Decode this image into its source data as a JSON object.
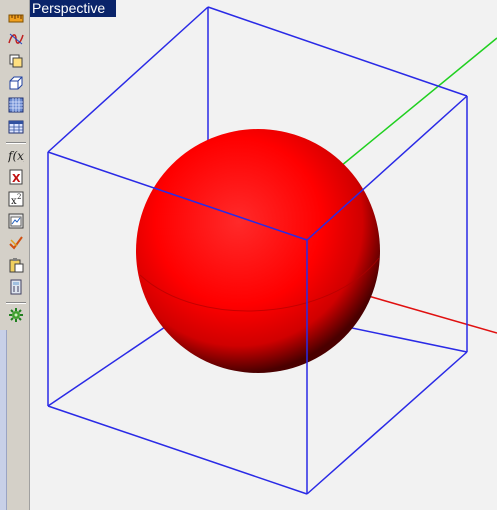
{
  "viewport": {
    "title": "Perspective",
    "colors": {
      "background": "#f2f2f2",
      "bounding_box": "#2a2ae6",
      "x_axis": "#e01010",
      "y_axis": "#20d020",
      "sphere": "#ff0000",
      "title_bar": "#0a246a"
    }
  },
  "toolbar": {
    "tools": [
      {
        "name": "ruler-icon"
      },
      {
        "name": "curve-icon"
      },
      {
        "name": "copy-view-icon"
      },
      {
        "name": "box-icon"
      },
      {
        "name": "grid-icon"
      },
      {
        "name": "table-icon"
      },
      {
        "name": "function-icon"
      },
      {
        "name": "excel-icon"
      },
      {
        "name": "power-icon"
      },
      {
        "name": "chart-window-icon"
      },
      {
        "name": "check-scribble-icon"
      },
      {
        "name": "paste-icon"
      },
      {
        "name": "calculator-icon"
      },
      {
        "name": "gear-icon"
      }
    ]
  }
}
